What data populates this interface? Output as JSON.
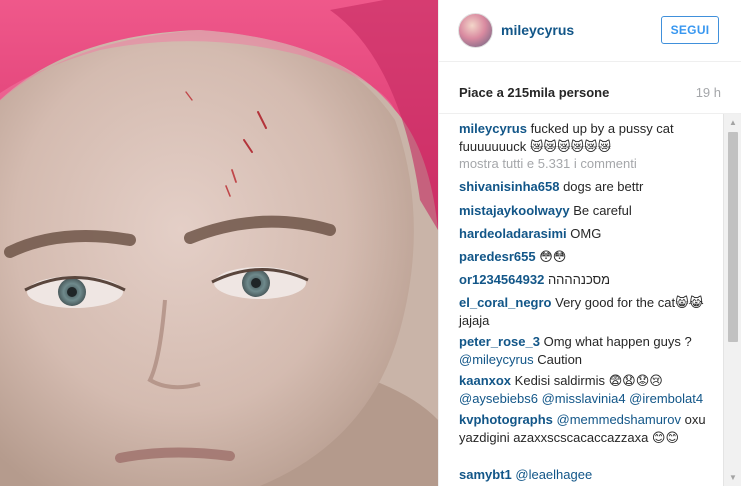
{
  "post": {
    "username": "mileycyrus",
    "follow_label": "SEGUI",
    "likes_text": "Piace a 215mila persone",
    "time_ago": "19 h",
    "caption": {
      "user": "mileycyrus",
      "text": "fucked up by a pussy cat fuuuuuuuck 😿😿😿😿😿😿"
    },
    "view_all_comments": "mostra tutti e 5.331 i commenti"
  },
  "comments": [
    {
      "user": "shivanisinha658",
      "text": "dogs are bettr"
    },
    {
      "user": "mistajaykoolwayy",
      "text": "Be careful"
    },
    {
      "user": "hardeoladarasimi",
      "text": "OMG"
    },
    {
      "user": "paredesr655",
      "text": "😳😳"
    },
    {
      "user": "or1234564932",
      "text": "מסכנהההה"
    },
    {
      "user": "el_coral_negro",
      "text": "Very good for the cat😸😹jajaja"
    },
    {
      "user": "peter_rose_3",
      "text": "Omg what happen guys ?",
      "mention": "@mileycyrus",
      "after": "Caution"
    },
    {
      "user": "kaanxox",
      "text": "Kedisi saldirmis 😨😧😟😢",
      "mention": "@aysebiebs6 @misslavinia4 @irembolat4"
    },
    {
      "user": "kvphotographs",
      "mention": "@memmedshamurov",
      "text": "oxu yazdigini azaxxscscacaccazzaxa 😊😊"
    },
    {
      "user": "samybt1",
      "mention": "@leaelhagee"
    }
  ],
  "colors": {
    "username_blue": "#125688",
    "follow_blue": "#3897f0",
    "muted_gray": "#a5a7aa",
    "towel_pink": "#e8417a"
  },
  "icons": {
    "scroll_up": "triangle-up",
    "scroll_down": "triangle-down"
  }
}
